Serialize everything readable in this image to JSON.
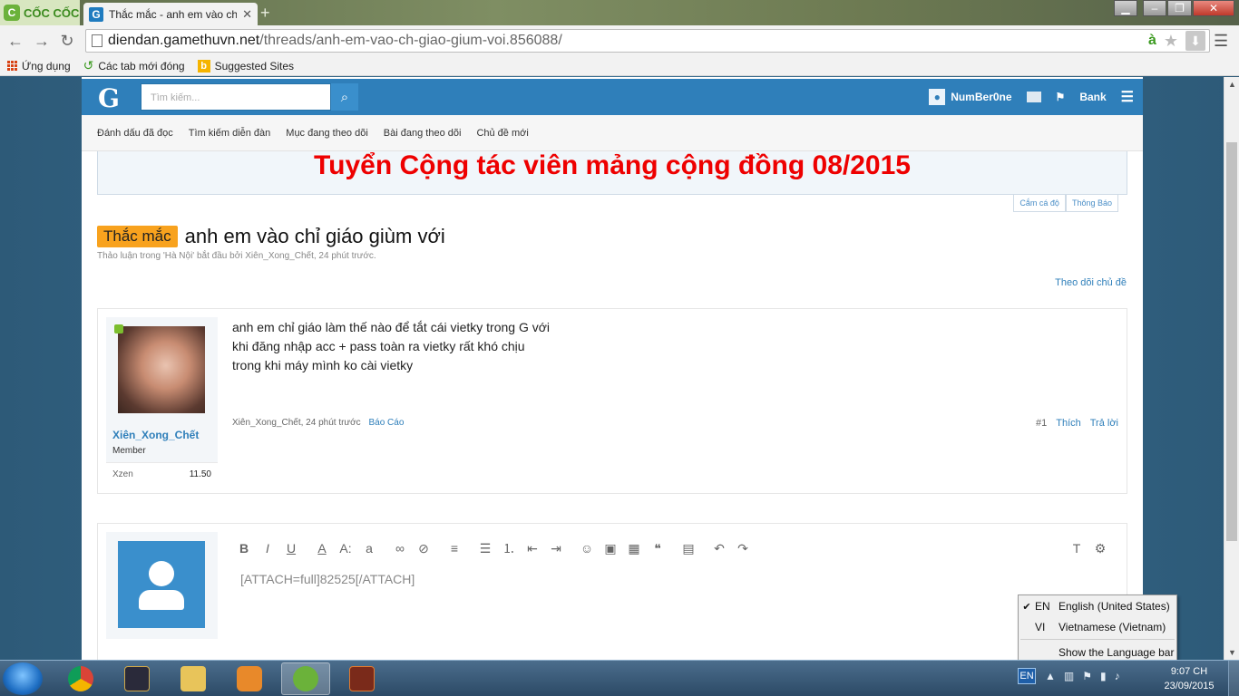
{
  "browser": {
    "brand": "CỐC CỐC",
    "tab_title": "Thắc mắc - anh em vào ch",
    "tab_close": "✕",
    "url_host": "diendan.gamethuvn.net",
    "url_path": "/threads/anh-em-vao-ch-giao-gium-voi.856088/",
    "bookmarks": [
      "Ứng dụng",
      "Các tab mới đóng",
      "Suggested Sites"
    ]
  },
  "site": {
    "logo": "G",
    "search_placeholder": "Tìm kiếm...",
    "username": "NumBer0ne",
    "bank": "Bank",
    "subnav": [
      "Đánh dấu đã đọc",
      "Tìm kiếm diễn đàn",
      "Mục đang theo dõi",
      "Bài đang theo dõi",
      "Chủ đề mới"
    ],
    "banner": "Tuyển Cộng tác viên mảng cộng đồng 08/2015",
    "tags": [
      "Cắm cá độ",
      "Thông Báo"
    ]
  },
  "thread": {
    "prefix": "Thắc mắc",
    "title": "anh em vào chỉ giáo giùm với",
    "meta": "Thảo luận trong 'Hà Nội' bắt đầu bởi Xiên_Xong_Chết, 24 phút trước.",
    "follow": "Theo dõi chủ đề"
  },
  "post": {
    "author": "Xiên_Xong_Chết",
    "role": "Member",
    "stat_key": "Xzen",
    "stat_val": "11.50",
    "lines": [
      "anh em chỉ giáo làm thế nào để tắt cái vietky trong G với",
      "khi đăng nhập acc + pass toàn ra vietky rất khó chịu",
      "trong khi máy mình ko cài vietky"
    ],
    "footer": "Xiên_Xong_Chết, 24 phút trước",
    "report": "Báo Cáo",
    "number": "#1",
    "like": "Thích",
    "reply": "Trả lời"
  },
  "editor": {
    "content": "[ATTACH=full]82525[/ATTACH]"
  },
  "language_menu": {
    "items": [
      {
        "code": "EN",
        "name": "English (United States)",
        "checked": true
      },
      {
        "code": "VI",
        "name": "Vietnamese (Vietnam)",
        "checked": false
      }
    ],
    "show_bar": "Show the Language bar"
  },
  "taskbar": {
    "lang": "EN",
    "time": "9:07 CH",
    "date": "23/09/2015"
  }
}
